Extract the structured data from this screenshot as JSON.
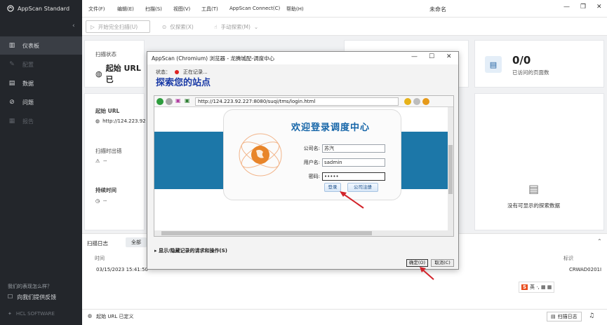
{
  "app": {
    "brand": "AppScan Standard",
    "window_title": "未命名"
  },
  "sidebar": {
    "items": [
      {
        "label": "仪表板",
        "icon": "dashboard-icon"
      },
      {
        "label": "配置",
        "icon": "wrench-icon"
      },
      {
        "label": "数据",
        "icon": "data-icon"
      },
      {
        "label": "问题",
        "icon": "issue-icon"
      },
      {
        "label": "报告",
        "icon": "report-icon"
      }
    ],
    "feedback_question": "我们的表现怎么样？",
    "feedback_link": "向我们提供反馈",
    "vendor": "HCL SOFTWARE"
  },
  "menu": [
    "文件(F)",
    "编辑(E)",
    "扫描(S)",
    "视图(V)",
    "工具(T)",
    "AppScan Connect(C)",
    "帮助(H)"
  ],
  "toolbar": {
    "full_scan": "开始完全扫描(U)",
    "explore_only": "仅探索(X)",
    "manual_explore": "手动探索(M)"
  },
  "dashboard": {
    "scan_status_label": "扫描状态",
    "scan_status_value": "起始 URL 已",
    "pages_count": "0/0",
    "pages_label": "已访问的页面数",
    "start_url_label": "起始 URL",
    "start_url_value": "http://124.223.92",
    "scan_errors_label": "扫描时出错",
    "scan_errors_value": "--",
    "duration_label": "持续时间",
    "duration_value": "--",
    "no_data": "没有可显示的探索数据"
  },
  "log": {
    "title": "扫描日志",
    "filter_all": "全部",
    "col_time": "时间",
    "col_id": "标识",
    "row_time": "03/15/2023 15:41:50",
    "row_id": "CRWAD0201I"
  },
  "statusbar": {
    "text": "起始 URL 已定义",
    "log_button": "扫描日志"
  },
  "dialog": {
    "title": "AppScan (Chromium) 浏览器 - 龙腾城配-调度中心",
    "state_label": "状态：",
    "state_value": "正在记录...",
    "heading": "探索您的站点",
    "url": "http://124.223.92.227:8080/suqi/tms/login.html",
    "toggle": "显示/隐藏记录的请求和操作(S)",
    "ok": "确定(O)",
    "cancel": "取消(C)"
  },
  "login": {
    "welcome": "欢迎登录调度中心",
    "company_label": "公司名:",
    "company_value": "苏汽",
    "user_label": "用户名:",
    "user_value": "sadmin",
    "password_label": "密码:",
    "password_value": "•••••",
    "login_button": "登录",
    "register_button": "公司注册"
  },
  "colors": {
    "sidebar": "#23262b",
    "accent_blue": "#1c77a8",
    "heading_blue": "#1a3aa6",
    "annotation_red": "#d2232a"
  }
}
